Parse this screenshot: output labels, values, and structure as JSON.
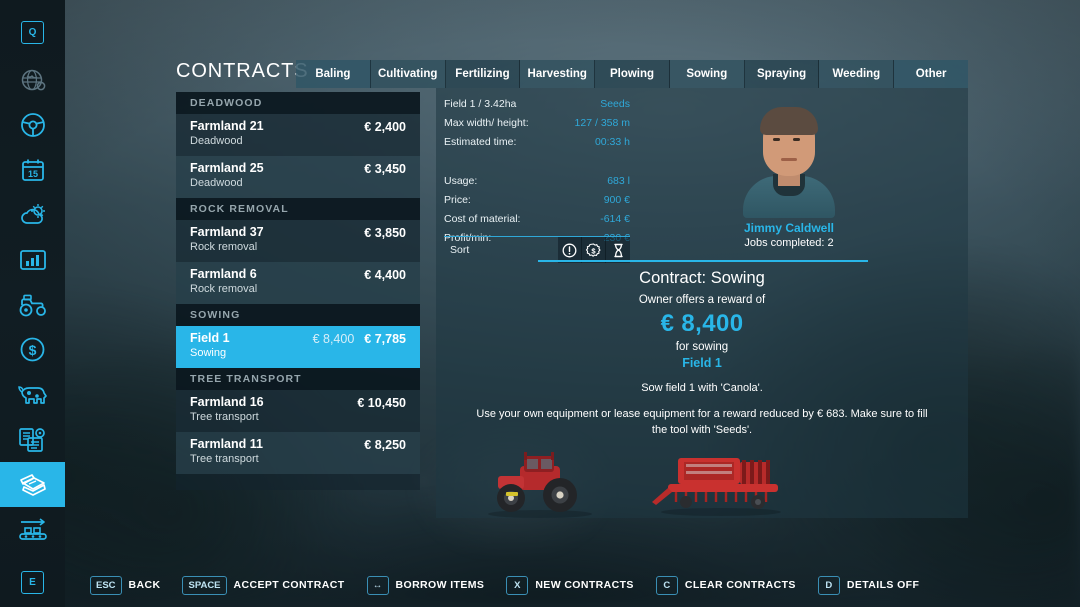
{
  "sidebar": {
    "items": [
      {
        "name": "menu-key-q",
        "icon": "key-q-icon",
        "key": "Q",
        "active": false
      },
      {
        "name": "map-overview",
        "icon": "globe-icon",
        "active": false
      },
      {
        "name": "vehicles",
        "icon": "steering-wheel-icon",
        "active": false
      },
      {
        "name": "calendar",
        "icon": "calendar-icon",
        "key": "15",
        "active": false
      },
      {
        "name": "weather",
        "icon": "weather-icon",
        "active": false
      },
      {
        "name": "statistics",
        "icon": "bar-chart-icon",
        "active": false
      },
      {
        "name": "garage",
        "icon": "tractor-icon",
        "active": false
      },
      {
        "name": "finances",
        "icon": "dollar-circle-icon",
        "active": false
      },
      {
        "name": "animals",
        "icon": "cow-icon",
        "active": false
      },
      {
        "name": "production",
        "icon": "production-icon",
        "active": false
      },
      {
        "name": "contracts",
        "icon": "contracts-icon",
        "active": true
      },
      {
        "name": "construction",
        "icon": "conveyor-icon",
        "active": false
      },
      {
        "name": "menu-key-e",
        "icon": "key-e-icon",
        "key": "E",
        "active": false
      }
    ]
  },
  "header": {
    "title": "CONTRACTS"
  },
  "tabs": [
    {
      "label": "Baling",
      "active": true
    },
    {
      "label": "Cultivating",
      "active": false
    },
    {
      "label": "Fertilizing",
      "active": false
    },
    {
      "label": "Harvesting",
      "active": false
    },
    {
      "label": "Plowing",
      "active": false
    },
    {
      "label": "Sowing",
      "active": false
    },
    {
      "label": "Spraying",
      "active": false
    },
    {
      "label": "Weeding",
      "active": false
    },
    {
      "label": "Other",
      "active": false
    }
  ],
  "list": {
    "groups": [
      {
        "title": "DEADWOOD",
        "rows": [
          {
            "name": "Farmland 21",
            "sub": "Deadwood",
            "price": "€ 2,400",
            "price_alt": "",
            "selected": false
          },
          {
            "name": "Farmland 25",
            "sub": "Deadwood",
            "price": "€ 3,450",
            "price_alt": "",
            "selected": false
          }
        ]
      },
      {
        "title": "ROCK REMOVAL",
        "rows": [
          {
            "name": "Farmland 37",
            "sub": "Rock removal",
            "price": "€ 3,850",
            "price_alt": "",
            "selected": false
          },
          {
            "name": "Farmland 6",
            "sub": "Rock removal",
            "price": "€ 4,400",
            "price_alt": "",
            "selected": false
          }
        ]
      },
      {
        "title": "SOWING",
        "rows": [
          {
            "name": "Field 1",
            "sub": "Sowing",
            "price": "€ 7,785",
            "price_alt": "€ 8,400",
            "selected": true
          }
        ]
      },
      {
        "title": "TREE TRANSPORT",
        "rows": [
          {
            "name": "Farmland 16",
            "sub": "Tree transport",
            "price": "€ 10,450",
            "price_alt": "",
            "selected": false
          },
          {
            "name": "Farmland 11",
            "sub": "Tree transport",
            "price": "€ 8,250",
            "price_alt": "",
            "selected": false
          }
        ]
      }
    ]
  },
  "stats": {
    "rows": [
      {
        "key": "Field 1 / 3.42ha",
        "value": "Seeds"
      },
      {
        "key": "Max width/ height:",
        "value": "127 / 358 m"
      },
      {
        "key": "Estimated time:",
        "value": "00:33 h"
      }
    ],
    "rows2": [
      {
        "key": "Usage:",
        "value": "683 l"
      },
      {
        "key": "Price:",
        "value": "900 €"
      },
      {
        "key": "Cost of material:",
        "value": "-614 €"
      },
      {
        "key": "Profit/min:",
        "value": "230 €"
      }
    ],
    "sort_label": "Sort",
    "sort_icons": [
      {
        "name": "sort-by-priority-icon",
        "glyph": "exclamation-circle-icon"
      },
      {
        "name": "sort-by-money-icon",
        "glyph": "coin-icon"
      },
      {
        "name": "sort-by-time-icon",
        "glyph": "hourglass-icon"
      }
    ]
  },
  "npc": {
    "name": "Jimmy Caldwell",
    "jobs_completed": "Jobs completed: 2"
  },
  "contract": {
    "title": "Contract: Sowing",
    "offer_line": "Owner offers a reward of",
    "reward": "€ 8,400",
    "for_line": "for sowing",
    "field": "Field 1",
    "task": "Sow field 1 with 'Canola'.",
    "note": "Use your own equipment or lease equipment for a reward reduced by € 683. Make sure to fill the tool with 'Seeds'.",
    "equipment": [
      {
        "name": "tractor-image",
        "alt": "red tractor"
      },
      {
        "name": "seeder-image",
        "alt": "red seeder implement"
      }
    ]
  },
  "helpbar": [
    {
      "key": "ESC",
      "label": "BACK"
    },
    {
      "key": "SPACE",
      "label": "ACCEPT CONTRACT"
    },
    {
      "key": "↔",
      "label": "BORROW ITEMS"
    },
    {
      "key": "X",
      "label": "NEW CONTRACTS"
    },
    {
      "key": "C",
      "label": "CLEAR CONTRACTS"
    },
    {
      "key": "D",
      "label": "DETAILS OFF"
    }
  ],
  "colors": {
    "accent": "#29b6e8",
    "value_text": "#2fa8d8",
    "panel_bg": "#1e3842",
    "sidebar_bg": "#0f1a1f",
    "group_header": "#96a6ad"
  }
}
